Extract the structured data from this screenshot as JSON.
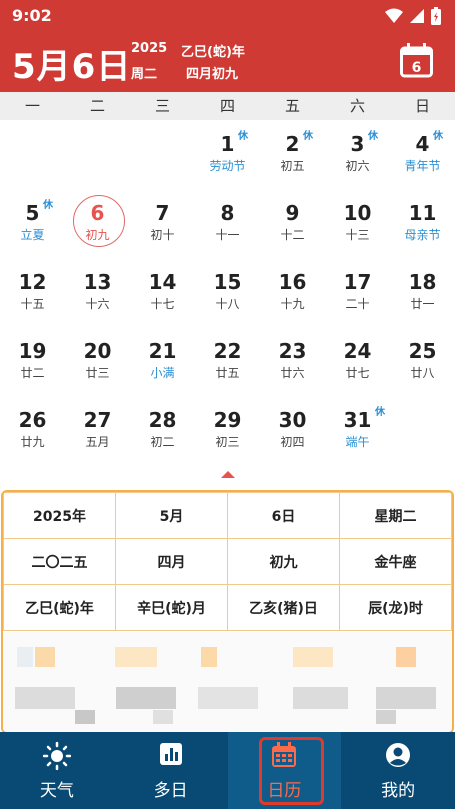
{
  "status": {
    "time": "9:02"
  },
  "header": {
    "date_big": "5月6日",
    "year": "2025",
    "ganzhi_year": "乙巳(蛇)年",
    "weekday": "周二",
    "lunar": "四月初九",
    "today_icon_day": "6"
  },
  "weekdays": [
    "一",
    "二",
    "三",
    "四",
    "五",
    "六",
    "日"
  ],
  "days": [
    {
      "n": "1",
      "s": "劳动节",
      "holiday": true,
      "rest": "休"
    },
    {
      "n": "2",
      "s": "初五",
      "rest": "休"
    },
    {
      "n": "3",
      "s": "初六",
      "rest": "休"
    },
    {
      "n": "4",
      "s": "青年节",
      "holiday": true,
      "rest": "休"
    },
    {
      "n": "5",
      "s": "立夏",
      "holiday": true,
      "rest": "休"
    },
    {
      "n": "6",
      "s": "初九",
      "selected": true
    },
    {
      "n": "7",
      "s": "初十"
    },
    {
      "n": "8",
      "s": "十一"
    },
    {
      "n": "9",
      "s": "十二"
    },
    {
      "n": "10",
      "s": "十三"
    },
    {
      "n": "11",
      "s": "母亲节",
      "holiday": true
    },
    {
      "n": "12",
      "s": "十五"
    },
    {
      "n": "13",
      "s": "十六"
    },
    {
      "n": "14",
      "s": "十七"
    },
    {
      "n": "15",
      "s": "十八"
    },
    {
      "n": "16",
      "s": "十九"
    },
    {
      "n": "17",
      "s": "二十"
    },
    {
      "n": "18",
      "s": "廿一"
    },
    {
      "n": "19",
      "s": "廿二"
    },
    {
      "n": "20",
      "s": "廿三"
    },
    {
      "n": "21",
      "s": "小满",
      "holiday": true
    },
    {
      "n": "22",
      "s": "廿五"
    },
    {
      "n": "23",
      "s": "廿六"
    },
    {
      "n": "24",
      "s": "廿七"
    },
    {
      "n": "25",
      "s": "廿八"
    },
    {
      "n": "26",
      "s": "廿九"
    },
    {
      "n": "27",
      "s": "五月"
    },
    {
      "n": "28",
      "s": "初二"
    },
    {
      "n": "29",
      "s": "初三"
    },
    {
      "n": "30",
      "s": "初四"
    },
    {
      "n": "31",
      "s": "端午",
      "holiday": true,
      "rest": "休"
    }
  ],
  "info_rows": [
    [
      "2025年",
      "5月",
      "6日",
      "星期二"
    ],
    [
      "二〇二五",
      "四月",
      "初九",
      "金牛座"
    ],
    [
      "乙巳(蛇)年",
      "辛巳(蛇)月",
      "乙亥(猪)日",
      "辰(龙)时"
    ]
  ],
  "tabs": [
    {
      "label": "天气",
      "icon": "sun-icon"
    },
    {
      "label": "多日",
      "icon": "bar-chart-icon"
    },
    {
      "label": "日历",
      "icon": "calendar-icon",
      "active": true
    },
    {
      "label": "我的",
      "icon": "user-icon"
    }
  ],
  "colors": {
    "brand": "#d03a35",
    "tabbar": "#094a75",
    "holiday": "#2a8fd6",
    "selected": "#e5544f",
    "info_border": "#f5b04e"
  }
}
